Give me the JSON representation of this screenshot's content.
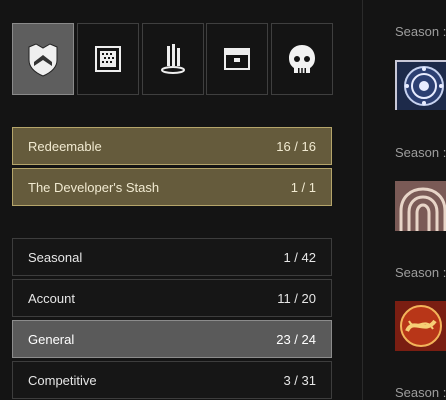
{
  "tabs": [
    {
      "icon": "emblem-shield-icon",
      "active": true
    },
    {
      "icon": "grid-pattern-icon",
      "active": false
    },
    {
      "icon": "monument-icon",
      "active": false
    },
    {
      "icon": "chest-icon",
      "active": false
    },
    {
      "icon": "ghost-shell-icon",
      "active": false
    }
  ],
  "featured": [
    {
      "label": "Redeemable",
      "count": "16 / 16"
    },
    {
      "label": "The Developer's Stash",
      "count": "1 / 1"
    }
  ],
  "categories": [
    {
      "label": "Seasonal",
      "count": "1 / 42"
    },
    {
      "label": "Account",
      "count": "11 / 20"
    },
    {
      "label": "General",
      "count": "23 / 24"
    },
    {
      "label": "Competitive",
      "count": "3 / 31"
    }
  ],
  "right_panel": {
    "season_labels": [
      "Season :",
      "Season :",
      "Season :",
      "Season :"
    ],
    "icons": [
      "celestial-emblem-icon",
      "arch-emblem-icon",
      "serpent-emblem-icon"
    ]
  },
  "colors": {
    "background": "#141414",
    "gold_fill": "#655b3c",
    "gold_border": "#b5a56a",
    "selected_fill": "#5a5a5a"
  }
}
